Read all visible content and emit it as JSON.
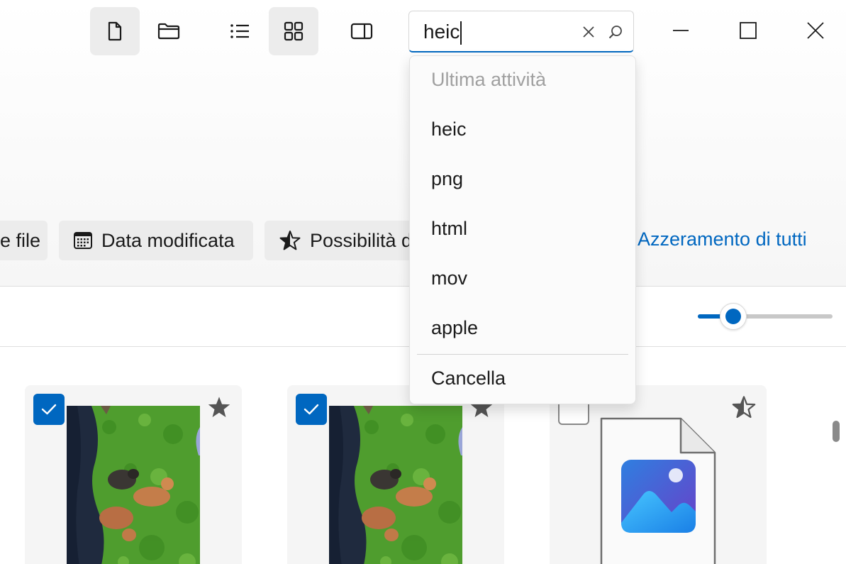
{
  "toolbar": {
    "buttons": [
      {
        "name": "new-file-button",
        "icon": "file-icon",
        "active": true
      },
      {
        "name": "open-folder-button",
        "icon": "folder-icon",
        "active": false
      },
      {
        "name": "list-view-button",
        "icon": "list-icon",
        "active": false
      },
      {
        "name": "grid-view-button",
        "icon": "grid-icon",
        "active": true
      },
      {
        "name": "preview-pane-button",
        "icon": "preview-pane-icon",
        "active": false
      }
    ]
  },
  "search": {
    "value": "heic",
    "clear_icon": "close-icon",
    "search_icon": "search-icon"
  },
  "window_controls": [
    "minimize-icon",
    "maximize-icon",
    "close-icon"
  ],
  "filters": {
    "chips": [
      {
        "label": "e file",
        "icon": ""
      },
      {
        "label": "Data modificata",
        "icon": "calendar-icon"
      },
      {
        "label": "Possibilità d",
        "icon": "star-half-icon"
      }
    ],
    "reset_label": "Azzeramento di tutti"
  },
  "zoom_slider": {
    "level": 0.22
  },
  "files": [
    {
      "selected": true,
      "favorite": true,
      "type": "photo"
    },
    {
      "selected": true,
      "favorite": true,
      "type": "photo"
    },
    {
      "selected": false,
      "favorite": false,
      "type": "image-file"
    }
  ],
  "dropdown": {
    "header": "Ultima attività",
    "items": [
      "heic",
      "png",
      "html",
      "mov",
      "apple"
    ],
    "clear_label": "Cancella"
  },
  "colors": {
    "accent": "#0067c0",
    "chip_bg": "#ececec"
  }
}
